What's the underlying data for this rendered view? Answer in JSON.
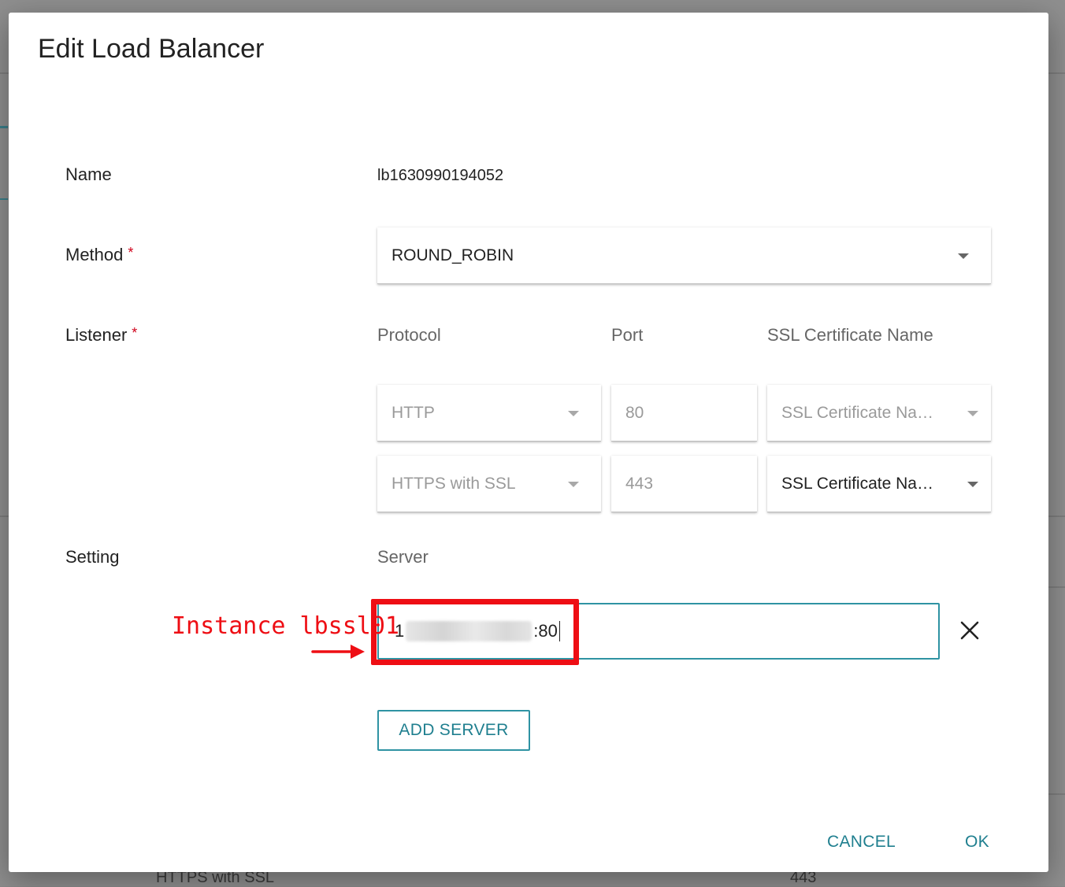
{
  "background": {
    "bottom_row": {
      "protocol": "HTTPS with SSL",
      "port": "443"
    }
  },
  "dialog": {
    "title": "Edit Load Balancer",
    "name": {
      "label": "Name",
      "value": "lb1630990194052"
    },
    "method": {
      "label": "Method",
      "required_mark": "*",
      "selected": "ROUND_ROBIN"
    },
    "listener": {
      "label": "Listener",
      "required_mark": "*",
      "columns": [
        "Protocol",
        "Port",
        "SSL Certificate Name"
      ],
      "rows": [
        {
          "protocol": "HTTP",
          "port": "80",
          "ssl_certificate": "SSL Certificate Na…"
        },
        {
          "protocol": "HTTPS with SSL",
          "port": "443",
          "ssl_certificate": "SSL Certificate Na…"
        }
      ]
    },
    "setting": {
      "label": "Setting",
      "server_label": "Server",
      "server_value_prefix": "1",
      "server_value_suffix": ":80"
    },
    "add_server_label": "ADD SERVER",
    "cancel_label": "CANCEL",
    "ok_label": "OK"
  },
  "annotation": {
    "text": "Instance lbssl01",
    "color": "#ee0e14"
  },
  "colors": {
    "accent": "#2f93a3",
    "required": "#d0021b"
  }
}
